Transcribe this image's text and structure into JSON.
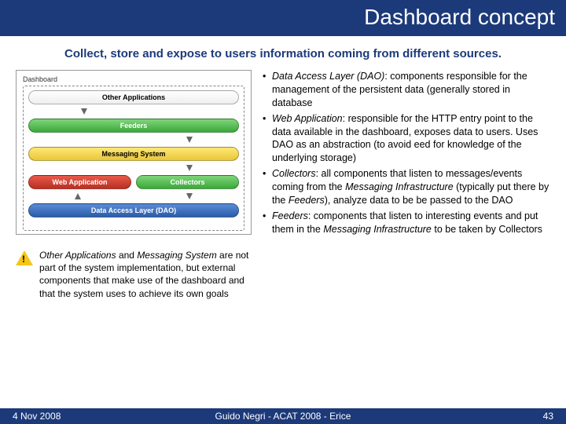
{
  "header": {
    "title": "Dashboard concept"
  },
  "subtitle": "Collect, store and expose to users information coming from different sources.",
  "diagram": {
    "label": "Dashboard",
    "boxes": {
      "other_apps": "Other Applications",
      "feeders": "Feeders",
      "messaging": "Messaging System",
      "webapp": "Web Application",
      "collectors": "Collectors",
      "dao": "Data Access Layer (DAO)"
    }
  },
  "warning": {
    "pre": "Other Applications",
    "mid1": " and ",
    "ms": "Messaging System",
    "post": " are not part of the system implementation, but external components that make use of the dashboard and that the system uses to achieve its own goals"
  },
  "bullets": {
    "b1a": "Data Access Layer (DAO)",
    "b1b": ": components responsible for the management of the persistent data (generally stored in database",
    "b2a": "Web Application",
    "b2b": ": responsible for the HTTP entry point to the data available in the dashboard, exposes data to users. Uses DAO as an abstraction (to avoid eed for knowledge of the underlying storage)",
    "b3a": "Collectors",
    "b3b": ": all components that listen to messages/events coming from the ",
    "b3c": "Messaging Infrastructure",
    "b3d": " (typically put there by the ",
    "b3e": "Feeders",
    "b3f": "), analyze data to be be passed to the DAO",
    "b4a": "Feeders",
    "b4b": ": components that listen to interesting events and put them in the ",
    "b4c": "Messaging Infrastructure",
    "b4d": " to be taken by Collectors"
  },
  "footer": {
    "date": "4 Nov 2008",
    "center": "Guido Negri - ACAT 2008 - Erice",
    "page": "43"
  }
}
